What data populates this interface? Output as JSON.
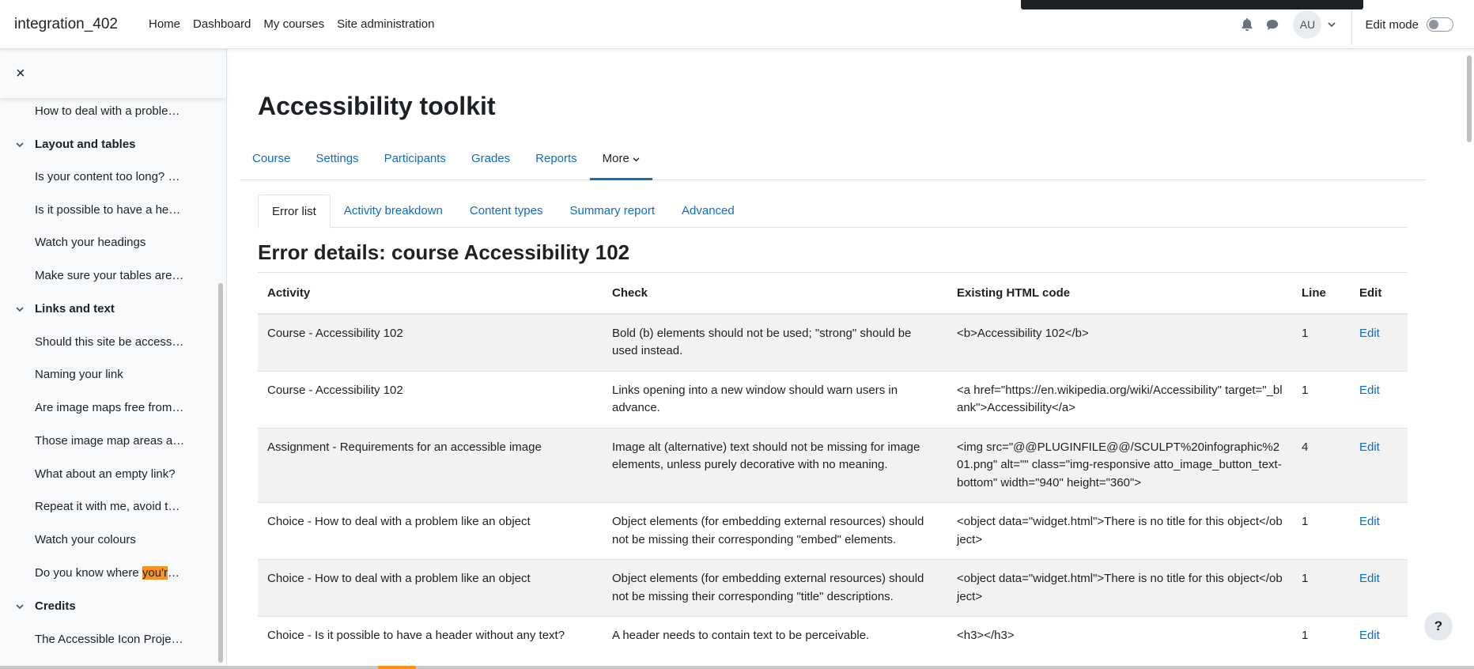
{
  "brand": "integration_402",
  "primary_nav": [
    "Home",
    "Dashboard",
    "My courses",
    "Site administration"
  ],
  "user_initials": "AU",
  "edit_mode_label": "Edit mode",
  "drawer": {
    "close": "×",
    "rows": [
      {
        "type": "item",
        "label": "How to deal with a proble…"
      },
      {
        "type": "section",
        "label": "Layout and tables"
      },
      {
        "type": "item",
        "label": "Is your content too long? …"
      },
      {
        "type": "item",
        "label": "Is it possible to have a he…"
      },
      {
        "type": "item",
        "label": "Watch your headings"
      },
      {
        "type": "item",
        "label": "Make sure your tables are…"
      },
      {
        "type": "section",
        "label": "Links and text"
      },
      {
        "type": "item",
        "label": "Should this site be access…"
      },
      {
        "type": "item",
        "label": "Naming your link"
      },
      {
        "type": "item",
        "label": "Are image maps free from…"
      },
      {
        "type": "item",
        "label": "Those image map areas a…"
      },
      {
        "type": "item",
        "label": "What about an empty link?"
      },
      {
        "type": "item",
        "label": "Repeat it with me, avoid t…"
      },
      {
        "type": "item",
        "label": "Watch your colours"
      },
      {
        "type": "item",
        "label": "Do you know where ",
        "highlight": "you'r",
        "suffix": "…"
      },
      {
        "type": "section",
        "label": "Credits"
      },
      {
        "type": "item",
        "label": "The Accessible Icon Proje…"
      }
    ]
  },
  "page_title": "Accessibility toolkit",
  "secondary_nav": [
    "Course",
    "Settings",
    "Participants",
    "Grades",
    "Reports",
    "More"
  ],
  "tabs": [
    "Error list",
    "Activity breakdown",
    "Content types",
    "Summary report",
    "Advanced"
  ],
  "error_title": "Error details: course Accessibility 102",
  "table": {
    "headers": [
      "Activity",
      "Check",
      "Existing HTML code",
      "Line",
      "Edit"
    ],
    "rows": [
      {
        "activity": "Course - Accessibility 102",
        "check": "Bold (b) elements should not be used; \"strong\" should be used instead.",
        "code": "<b>Accessibility 102</b>",
        "line": "1",
        "edit": "Edit"
      },
      {
        "activity": "Course - Accessibility 102",
        "check": "Links opening into a new window should warn users in advance.",
        "code": "<a href=\"https://en.wikipedia.org/wiki/Accessibility\" target=\"_blank\">Accessibility</a>",
        "line": "1",
        "edit": "Edit"
      },
      {
        "activity": "Assignment - Requirements for an accessible image",
        "check": "Image alt (alternative) text should not be missing for image elements, unless purely decorative with no meaning.",
        "code": "<img src=\"@@PLUGINFILE@@/SCULPT%20infographic%201.png\" alt=\"\" class=\"img-responsive atto_image_button_text-bottom\" width=\"940\" height=\"360\">",
        "line": "4",
        "edit": "Edit"
      },
      {
        "activity": "Choice - How to deal with a problem like an object",
        "check": "Object elements (for embedding external resources) should not be missing their corresponding \"embed\" elements.",
        "code": "<object data=\"widget.html\">There is no title for this object</object>",
        "line": "1",
        "edit": "Edit"
      },
      {
        "activity": "Choice - How to deal with a problem like an object",
        "check": "Object elements (for embedding external resources) should not be missing their corresponding \"title\" descriptions.",
        "code": "<object data=\"widget.html\">There is no title for this object</object>",
        "line": "1",
        "edit": "Edit"
      },
      {
        "activity": "Choice - Is it possible to have a header without any text?",
        "check": "A header needs to contain text to be perceivable.",
        "code": "<h3></h3>",
        "line": "1",
        "edit": "Edit"
      }
    ]
  },
  "help": "?"
}
